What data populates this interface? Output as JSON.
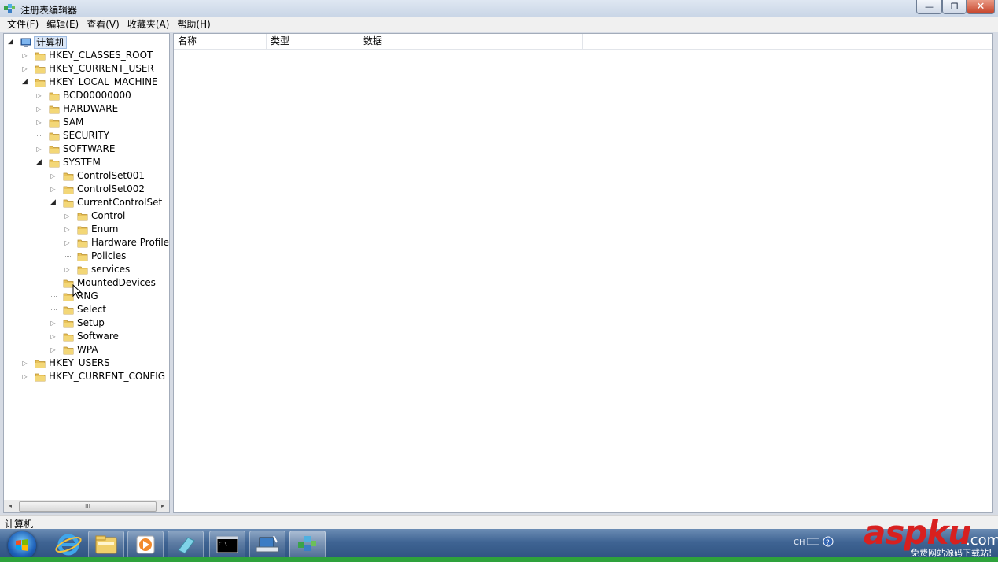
{
  "window": {
    "title": "注册表编辑器",
    "min_label": "—",
    "max_label": "❐",
    "close_label": "✕"
  },
  "menu": [
    "文件(F)",
    "编辑(E)",
    "查看(V)",
    "收藏夹(A)",
    "帮助(H)"
  ],
  "columns": {
    "name": "名称",
    "type": "类型",
    "data": "数据"
  },
  "tree": [
    {
      "label": "计算机",
      "level": 0,
      "state": "open",
      "icon": "computer-icon",
      "selected": true
    },
    {
      "label": "HKEY_CLASSES_ROOT",
      "level": 1,
      "state": "closed"
    },
    {
      "label": "HKEY_CURRENT_USER",
      "level": 1,
      "state": "closed"
    },
    {
      "label": "HKEY_LOCAL_MACHINE",
      "level": 1,
      "state": "open"
    },
    {
      "label": "BCD00000000",
      "level": 2,
      "state": "closed"
    },
    {
      "label": "HARDWARE",
      "level": 2,
      "state": "closed"
    },
    {
      "label": "SAM",
      "level": 2,
      "state": "closed"
    },
    {
      "label": "SECURITY",
      "level": 2,
      "state": "none"
    },
    {
      "label": "SOFTWARE",
      "level": 2,
      "state": "closed"
    },
    {
      "label": "SYSTEM",
      "level": 2,
      "state": "open"
    },
    {
      "label": "ControlSet001",
      "level": 3,
      "state": "closed"
    },
    {
      "label": "ControlSet002",
      "level": 3,
      "state": "closed"
    },
    {
      "label": "CurrentControlSet",
      "level": 3,
      "state": "open"
    },
    {
      "label": "Control",
      "level": 4,
      "state": "closed"
    },
    {
      "label": "Enum",
      "level": 4,
      "state": "closed"
    },
    {
      "label": "Hardware Profiles",
      "level": 4,
      "state": "closed"
    },
    {
      "label": "Policies",
      "level": 4,
      "state": "none"
    },
    {
      "label": "services",
      "level": 4,
      "state": "closed"
    },
    {
      "label": "MountedDevices",
      "level": 3,
      "state": "none"
    },
    {
      "label": "RNG",
      "level": 3,
      "state": "none"
    },
    {
      "label": "Select",
      "level": 3,
      "state": "none"
    },
    {
      "label": "Setup",
      "level": 3,
      "state": "closed"
    },
    {
      "label": "Software",
      "level": 3,
      "state": "closed"
    },
    {
      "label": "WPA",
      "level": 3,
      "state": "closed"
    },
    {
      "label": "HKEY_USERS",
      "level": 1,
      "state": "closed"
    },
    {
      "label": "HKEY_CURRENT_CONFIG",
      "level": 1,
      "state": "closed"
    }
  ],
  "scrollbar": {
    "left": "◂",
    "right": "▸",
    "thumb": "III"
  },
  "status": "计算机",
  "tray": {
    "lang": "CH"
  },
  "watermark": {
    "brand": "aspku",
    "tld": ".com",
    "sub": "免费网站源码下载站!"
  },
  "colors": {
    "folder": "#e8c25a",
    "selection": "#dbe7f7",
    "taskbar": "#3f6493"
  }
}
